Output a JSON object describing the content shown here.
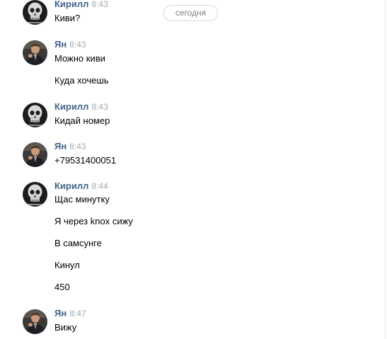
{
  "date_divider": "сегодня",
  "messages": [
    {
      "author": "Кирилл",
      "time": "8:43",
      "avatar": "skull-avatar",
      "lines": [
        "Киви?"
      ]
    },
    {
      "author": "Ян",
      "time": "8:43",
      "avatar": "man-in-suit-avatar",
      "lines": [
        "Можно киви",
        "Куда хочешь"
      ]
    },
    {
      "author": "Кирилл",
      "time": "8:43",
      "avatar": "skull-avatar",
      "lines": [
        "Кидай номер"
      ]
    },
    {
      "author": "Ян",
      "time": "8:43",
      "avatar": "man-in-suit-avatar",
      "lines": [
        "+79531400051"
      ]
    },
    {
      "author": "Кирилл",
      "time": "8:44",
      "avatar": "skull-avatar",
      "lines": [
        "Щас минутку",
        "Я через knox сижу",
        "В самсунге",
        "Кинул",
        "450"
      ]
    },
    {
      "author": "Ян",
      "time": "8:47",
      "avatar": "man-in-suit-avatar",
      "lines": [
        "Вижу"
      ]
    }
  ]
}
